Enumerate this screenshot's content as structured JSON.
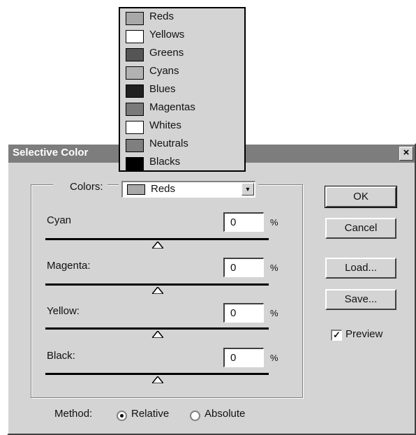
{
  "dialog": {
    "title": "Selective Color",
    "close_label": "×",
    "colors_label": "Colors:",
    "colors_selected": "Reds",
    "sliders": [
      {
        "label": "Cyan",
        "value": "0",
        "unit": "%"
      },
      {
        "label": "Magenta:",
        "value": "0",
        "unit": "%"
      },
      {
        "label": "Yellow:",
        "value": "0",
        "unit": "%"
      },
      {
        "label": "Black:",
        "value": "0",
        "unit": "%"
      }
    ],
    "buttons": {
      "ok": "OK",
      "cancel": "Cancel",
      "load": "Load...",
      "save": "Save..."
    },
    "preview": {
      "label": "Preview",
      "checked": true,
      "check_mark": "✓"
    },
    "method": {
      "label": "Method:",
      "relative": "Relative",
      "absolute": "Absolute",
      "selected": "Relative"
    }
  },
  "dropdown": {
    "items": [
      {
        "label": "Reds",
        "color": "#a8a8a8"
      },
      {
        "label": "Yellows",
        "color": "#ffffff"
      },
      {
        "label": "Greens",
        "color": "#555555"
      },
      {
        "label": "Cyans",
        "color": "#b2b2b2"
      },
      {
        "label": "Blues",
        "color": "#202020"
      },
      {
        "label": "Magentas",
        "color": "#7a7a7a"
      },
      {
        "label": "Whites",
        "color": "#ffffff"
      },
      {
        "label": "Neutrals",
        "color": "#7f7f7f"
      },
      {
        "label": "Blacks",
        "color": "#000000"
      }
    ]
  }
}
